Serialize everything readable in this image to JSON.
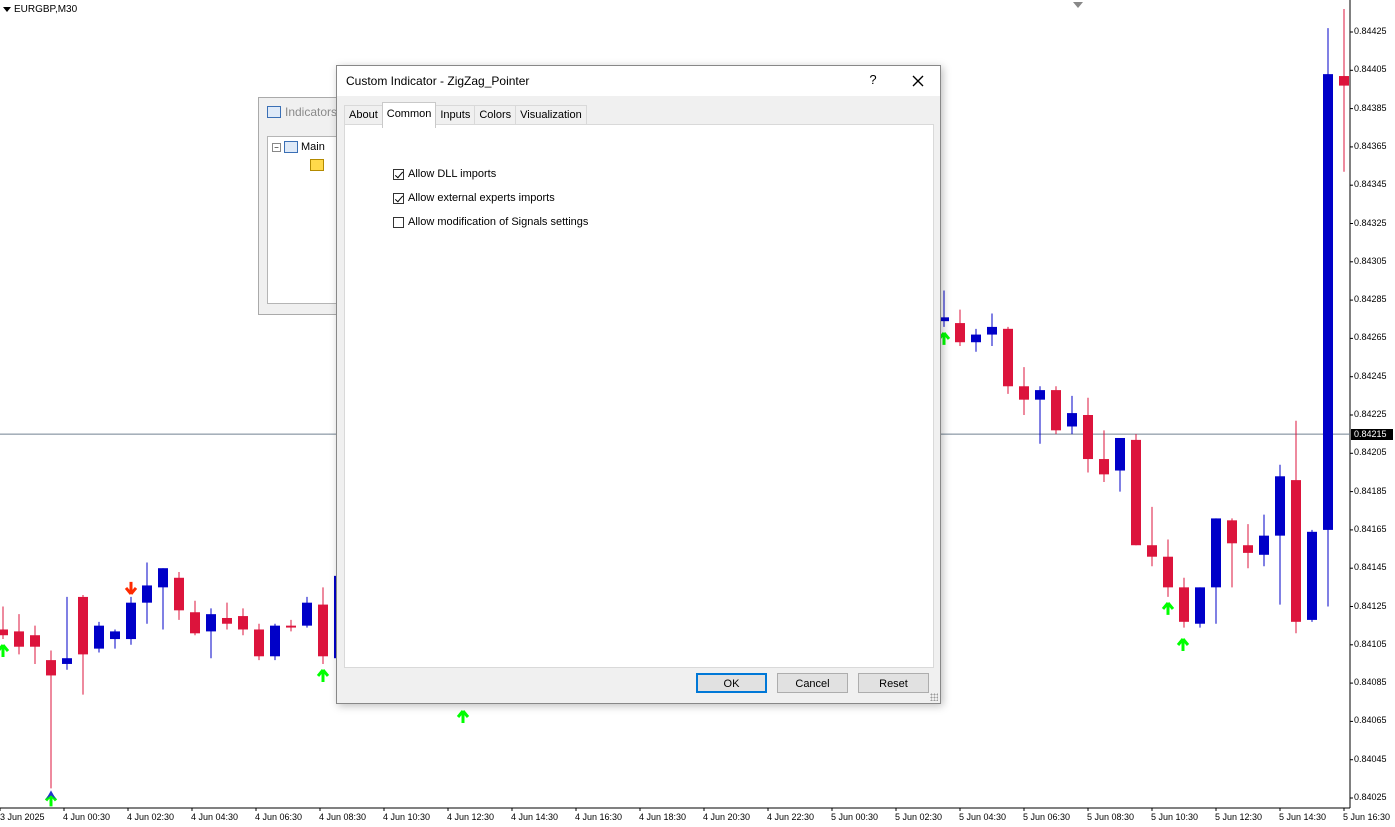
{
  "chart": {
    "symbol_label": "EURGBP,M30",
    "current_price": "0.84215",
    "price_ticks": [
      "0.84425",
      "0.84405",
      "0.84385",
      "0.84365",
      "0.84345",
      "0.84325",
      "0.84305",
      "0.84285",
      "0.84265",
      "0.84245",
      "0.84225",
      "0.84205",
      "0.84185",
      "0.84165",
      "0.84145",
      "0.84125",
      "0.84105",
      "0.84085",
      "0.84065",
      "0.84045",
      "0.84025"
    ],
    "time_ticks": [
      "3 Jun 2025",
      "4 Jun 00:30",
      "4 Jun 02:30",
      "4 Jun 04:30",
      "4 Jun 06:30",
      "4 Jun 08:30",
      "4 Jun 10:30",
      "4 Jun 12:30",
      "4 Jun 14:30",
      "4 Jun 16:30",
      "4 Jun 18:30",
      "4 Jun 20:30",
      "4 Jun 22:30",
      "5 Jun 00:30",
      "5 Jun 02:30",
      "5 Jun 04:30",
      "5 Jun 06:30",
      "5 Jun 08:30",
      "5 Jun 10:30",
      "5 Jun 12:30",
      "5 Jun 14:30",
      "5 Jun 16:30"
    ],
    "colors": {
      "bull": "#0000c8",
      "bear": "#dc143c",
      "up_arrow": "#00ff00",
      "down_arrow": "#ff2a00",
      "price_line": "#708090"
    }
  },
  "chart_data": {
    "type": "candlestick",
    "title": "",
    "ylim": [
      0.84015,
      0.84435
    ],
    "candles": [
      {
        "o": 0.84113,
        "h": 0.84125,
        "l": 0.84108,
        "c": 0.8411
      },
      {
        "o": 0.84112,
        "h": 0.84121,
        "l": 0.841,
        "c": 0.84104
      },
      {
        "o": 0.8411,
        "h": 0.84115,
        "l": 0.84095,
        "c": 0.84104
      },
      {
        "o": 0.84097,
        "h": 0.84102,
        "l": 0.8403,
        "c": 0.84089
      },
      {
        "o": 0.84095,
        "h": 0.8413,
        "l": 0.84092,
        "c": 0.84098
      },
      {
        "o": 0.8413,
        "h": 0.84131,
        "l": 0.84079,
        "c": 0.841
      },
      {
        "o": 0.84103,
        "h": 0.84117,
        "l": 0.84101,
        "c": 0.84115
      },
      {
        "o": 0.84108,
        "h": 0.84113,
        "l": 0.84103,
        "c": 0.84112
      },
      {
        "o": 0.84108,
        "h": 0.8413,
        "l": 0.84105,
        "c": 0.84127
      },
      {
        "o": 0.84127,
        "h": 0.84148,
        "l": 0.84116,
        "c": 0.84136
      },
      {
        "o": 0.84135,
        "h": 0.84145,
        "l": 0.84113,
        "c": 0.84145
      },
      {
        "o": 0.8414,
        "h": 0.84143,
        "l": 0.84118,
        "c": 0.84123
      },
      {
        "o": 0.84122,
        "h": 0.84128,
        "l": 0.8411,
        "c": 0.84111
      },
      {
        "o": 0.84112,
        "h": 0.84124,
        "l": 0.84098,
        "c": 0.84121
      },
      {
        "o": 0.84119,
        "h": 0.84127,
        "l": 0.84113,
        "c": 0.84116
      },
      {
        "o": 0.8412,
        "h": 0.84124,
        "l": 0.8411,
        "c": 0.84113
      },
      {
        "o": 0.84113,
        "h": 0.84116,
        "l": 0.84097,
        "c": 0.84099
      },
      {
        "o": 0.84099,
        "h": 0.84116,
        "l": 0.84097,
        "c": 0.84115
      },
      {
        "o": 0.84115,
        "h": 0.84118,
        "l": 0.84112,
        "c": 0.84114
      },
      {
        "o": 0.84115,
        "h": 0.8413,
        "l": 0.84114,
        "c": 0.84127
      },
      {
        "o": 0.84126,
        "h": 0.84135,
        "l": 0.84095,
        "c": 0.84099
      },
      {
        "o": 0.84098,
        "h": 0.84142,
        "l": 0.84088,
        "c": 0.84141
      },
      {
        "o": 0.84274,
        "h": 0.8429,
        "l": 0.84271,
        "c": 0.84276
      },
      {
        "o": 0.84273,
        "h": 0.8428,
        "l": 0.84261,
        "c": 0.84263
      },
      {
        "o": 0.84263,
        "h": 0.8427,
        "l": 0.84258,
        "c": 0.84267
      },
      {
        "o": 0.84267,
        "h": 0.84278,
        "l": 0.84261,
        "c": 0.84271
      },
      {
        "o": 0.8427,
        "h": 0.84271,
        "l": 0.84236,
        "c": 0.8424
      },
      {
        "o": 0.8424,
        "h": 0.8425,
        "l": 0.84225,
        "c": 0.84233
      },
      {
        "o": 0.84233,
        "h": 0.8424,
        "l": 0.8421,
        "c": 0.84238
      },
      {
        "o": 0.84238,
        "h": 0.8424,
        "l": 0.84215,
        "c": 0.84217
      },
      {
        "o": 0.84219,
        "h": 0.84235,
        "l": 0.84215,
        "c": 0.84226
      },
      {
        "o": 0.84225,
        "h": 0.84234,
        "l": 0.84195,
        "c": 0.84202
      },
      {
        "o": 0.84202,
        "h": 0.84217,
        "l": 0.8419,
        "c": 0.84194
      },
      {
        "o": 0.84196,
        "h": 0.84213,
        "l": 0.84185,
        "c": 0.84213
      },
      {
        "o": 0.84212,
        "h": 0.84215,
        "l": 0.84157,
        "c": 0.84157
      },
      {
        "o": 0.84157,
        "h": 0.84177,
        "l": 0.84146,
        "c": 0.84151
      },
      {
        "o": 0.84151,
        "h": 0.8416,
        "l": 0.8413,
        "c": 0.84135
      },
      {
        "o": 0.84135,
        "h": 0.8414,
        "l": 0.84114,
        "c": 0.84117
      },
      {
        "o": 0.84116,
        "h": 0.84135,
        "l": 0.84114,
        "c": 0.84135
      },
      {
        "o": 0.84135,
        "h": 0.84171,
        "l": 0.84116,
        "c": 0.84171
      },
      {
        "o": 0.8417,
        "h": 0.84171,
        "l": 0.84135,
        "c": 0.84158
      },
      {
        "o": 0.84157,
        "h": 0.84168,
        "l": 0.84145,
        "c": 0.84153
      },
      {
        "o": 0.84152,
        "h": 0.84173,
        "l": 0.84146,
        "c": 0.84162
      },
      {
        "o": 0.84162,
        "h": 0.84199,
        "l": 0.84126,
        "c": 0.84193
      },
      {
        "o": 0.84191,
        "h": 0.84222,
        "l": 0.84111,
        "c": 0.84117
      },
      {
        "o": 0.84118,
        "h": 0.84165,
        "l": 0.84117,
        "c": 0.84164
      },
      {
        "o": 0.84165,
        "h": 0.84427,
        "l": 0.84125,
        "c": 0.84403
      },
      {
        "o": 0.84402,
        "h": 0.84437,
        "l": 0.84352,
        "c": 0.84397
      }
    ],
    "arrows_up": [
      0,
      3,
      20,
      22,
      36
    ],
    "arrows_down": [
      8
    ]
  },
  "dialog": {
    "title": "Custom Indicator - ZigZag_Pointer",
    "help_label": "?",
    "tabs": [
      "About",
      "Common",
      "Inputs",
      "Colors",
      "Visualization"
    ],
    "active_tab": "Common",
    "options": [
      {
        "label": "Allow DLL imports",
        "checked": true
      },
      {
        "label": "Allow external experts imports",
        "checked": true
      },
      {
        "label": "Allow modification of Signals settings",
        "checked": false
      }
    ],
    "buttons": {
      "ok": "OK",
      "cancel": "Cancel",
      "reset": "Reset"
    }
  },
  "indicators_window": {
    "title": "Indicators",
    "tree_root": "Main"
  }
}
